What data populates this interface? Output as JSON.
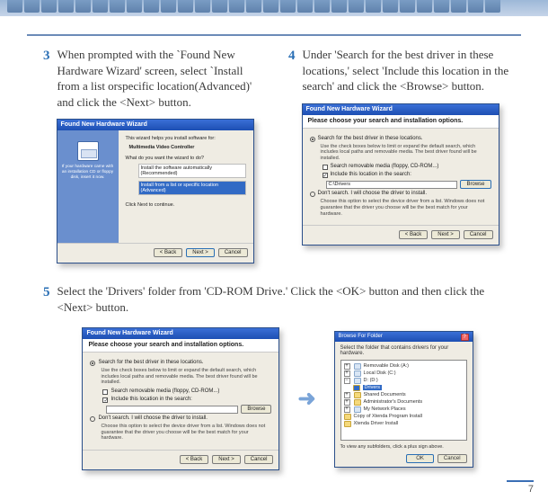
{
  "page_number": "7",
  "steps": {
    "s3": {
      "num": "3",
      "text": "When prompted with the `Found New Hardware Wizard' screen, select `Install from a list orspecific location(Advanced)' and click the <Next> button."
    },
    "s4": {
      "num": "4",
      "text": "Under 'Search for the best driver in these locations,' select 'Include this location in the search' and click the <Browse> button."
    },
    "s5": {
      "num": "5",
      "text": "Select the 'Drivers' folder from 'CD-ROM Drive.' Click the <OK> button and then click the <Next> button."
    }
  },
  "wiz_common": {
    "title": "Found New Hardware Wizard",
    "btn_back": "< Back",
    "btn_next": "Next >",
    "btn_cancel": "Cancel",
    "hdr_options": "Please choose your search and installation options."
  },
  "wiz3": {
    "line1": "This wizard helps you install software for:",
    "device": "Multimedia Video Controller",
    "cd_hint": "If your hardware came with an installation CD or floppy disk, insert it now.",
    "q": "What do you want the wizard to do?",
    "opt_auto": "Install the software automatically (Recommended)",
    "opt_list": "Install from a list or specific location (Advanced)",
    "cont": "Click Next to continue."
  },
  "wiz4": {
    "opt_search": "Search for the best driver in these locations.",
    "sub": "Use the check boxes below to limit or expand the default search, which includes local paths and removable media. The best driver found will be installed.",
    "chk_removable": "Search removable media (floppy, CD-ROM...)",
    "chk_include": "Include this location in the search:",
    "path": "C:\\Drivers",
    "btn_browse": "Browse",
    "opt_dont": "Don't search. I will choose the driver to install.",
    "sub2": "Choose this option to select the device driver from a list. Windows does not guarantee that the driver you choose will be the best match for your hardware."
  },
  "folder": {
    "title": "Browse For Folder",
    "prompt": "Select the folder that contains drivers for your hardware.",
    "items": {
      "removable": "Removable Disk (A:)",
      "localc": "Local Disk (C:)",
      "cdrom": "D: (D:)",
      "drivers": "Drivers",
      "shared": "Shared Documents",
      "admin": "Administrator's Documents",
      "network": "My Network Places",
      "copy": "Copy of Xtenda Program Install",
      "xtenda": "Xtenda Driver Install"
    },
    "hint": "To view any subfolders, click a plus sign above.",
    "btn_ok": "OK",
    "btn_cancel": "Cancel"
  }
}
